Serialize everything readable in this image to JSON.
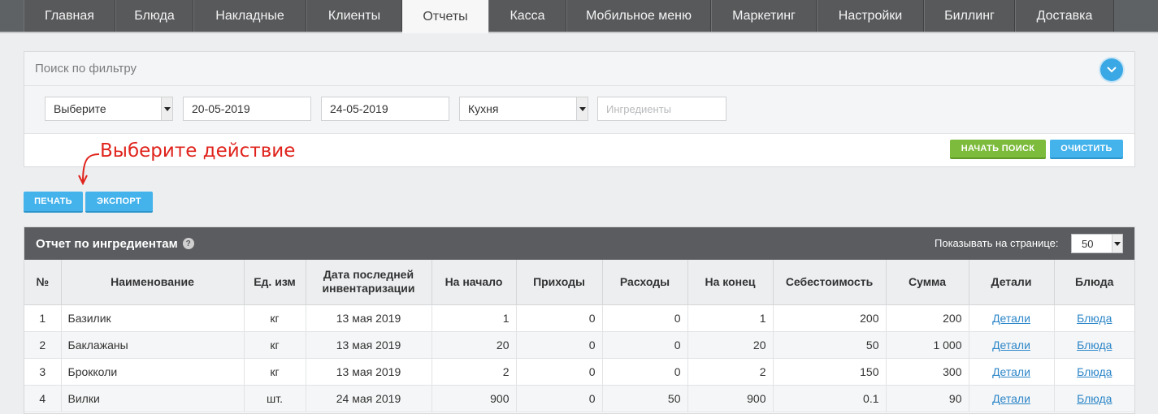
{
  "nav": {
    "tabs": [
      "Главная",
      "Блюда",
      "Накладные",
      "Клиенты",
      "Отчеты",
      "Касса",
      "Мобильное меню",
      "Маркетинг",
      "Настройки",
      "Биллинг",
      "Доставка"
    ],
    "active": "Отчеты"
  },
  "filter": {
    "title": "Поиск по фильтру",
    "select_action": "Выберите",
    "date_from": "20-05-2019",
    "date_to": "24-05-2019",
    "kitchen": "Кухня",
    "ingredients_placeholder": "Ингредиенты",
    "search_label": "НАЧАТЬ ПОИСК",
    "clear_label": "ОЧИСТИТЬ"
  },
  "annotation": "Выберите действие",
  "actions": {
    "print_label": "ПЕЧАТЬ",
    "export_label": "ЭКСПОРТ"
  },
  "report": {
    "title": "Отчет по ингредиентам",
    "help": "?",
    "per_page_label": "Показывать на странице:",
    "per_page_value": "50",
    "columns": [
      "№",
      "Наименование",
      "Ед. изм",
      "Дата последней инвентаризации",
      "На начало",
      "Приходы",
      "Расходы",
      "На конец",
      "Себестоимость",
      "Сумма",
      "Детали",
      "Блюда"
    ],
    "rows": [
      [
        "1",
        "Базилик",
        "кг",
        "13 мая 2019",
        "1",
        "0",
        "0",
        "1",
        "200",
        "200",
        "Детали",
        "Блюда"
      ],
      [
        "2",
        "Баклажаны",
        "кг",
        "13 мая 2019",
        "20",
        "0",
        "0",
        "20",
        "50",
        "1 000",
        "Детали",
        "Блюда"
      ],
      [
        "3",
        "Брокколи",
        "кг",
        "13 мая 2019",
        "2",
        "0",
        "0",
        "2",
        "150",
        "300",
        "Детали",
        "Блюда"
      ],
      [
        "4",
        "Вилки",
        "шт.",
        "24 мая 2019",
        "900",
        "0",
        "50",
        "900",
        "0.1",
        "90",
        "Детали",
        "Блюда"
      ]
    ]
  },
  "colors": {
    "nav_bg": "#58595b",
    "accent_blue": "#44b3ec",
    "accent_green": "#7cbb3b",
    "annotation_red": "#e0231c",
    "link": "#2c86c8"
  },
  "icons": {
    "toggle": "chevron-down-icon",
    "help": "question-icon"
  }
}
